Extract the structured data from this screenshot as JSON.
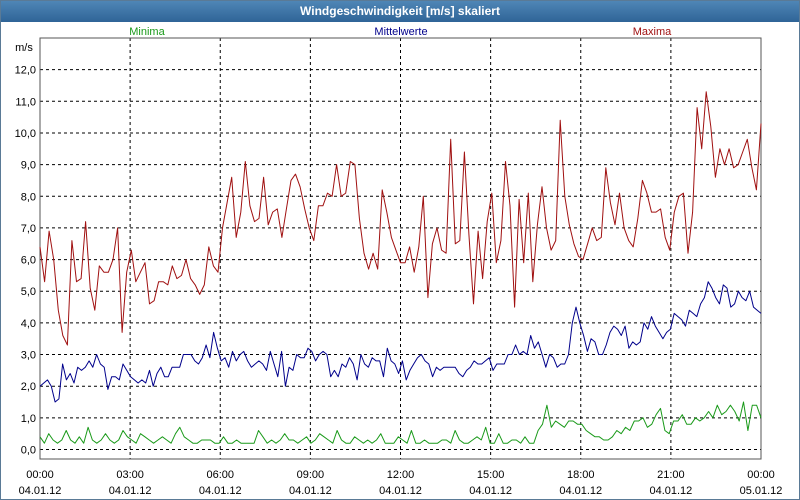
{
  "window": {
    "title": "Windgeschwindigkeit [m/s] skaliert"
  },
  "chart_data": {
    "type": "line",
    "title": "Windgeschwindigkeit [m/s] skaliert",
    "ylabel": "m/s",
    "ylim": [
      -0.3,
      13.0
    ],
    "xlim": [
      0,
      24
    ],
    "grid": true,
    "yticks": [
      "0,0",
      "1,0",
      "2,0",
      "3,0",
      "4,0",
      "5,0",
      "6,0",
      "7,0",
      "8,0",
      "9,0",
      "10,0",
      "11,0",
      "12,0"
    ],
    "xticks": [
      {
        "time": "00:00",
        "date": "04.01.12"
      },
      {
        "time": "03:00",
        "date": "04.01.12"
      },
      {
        "time": "06:00",
        "date": "04.01.12"
      },
      {
        "time": "09:00",
        "date": "04.01.12"
      },
      {
        "time": "12:00",
        "date": "04.01.12"
      },
      {
        "time": "15:00",
        "date": "04.01.12"
      },
      {
        "time": "18:00",
        "date": "04.01.12"
      },
      {
        "time": "21:00",
        "date": "04.01.12"
      },
      {
        "time": "00:00",
        "date": "05.01.12"
      }
    ],
    "series": [
      {
        "name": "Minima",
        "color": "#1a9a1a",
        "values": [
          0.4,
          0.2,
          0.5,
          0.3,
          0.2,
          0.3,
          0.6,
          0.3,
          0.2,
          0.4,
          0.2,
          0.7,
          0.3,
          0.2,
          0.3,
          0.5,
          0.3,
          0.2,
          0.3,
          0.6,
          0.4,
          0.3,
          0.2,
          0.5,
          0.4,
          0.3,
          0.2,
          0.3,
          0.4,
          0.3,
          0.2,
          0.5,
          0.7,
          0.4,
          0.3,
          0.2,
          0.2,
          0.3,
          0.3,
          0.3,
          0.2,
          0.2,
          0.4,
          0.2,
          0.2,
          0.3,
          0.2,
          0.2,
          0.2,
          0.2,
          0.6,
          0.4,
          0.2,
          0.3,
          0.2,
          0.3,
          0.5,
          0.3,
          0.3,
          0.2,
          0.3,
          0.4,
          0.2,
          0.3,
          0.5,
          0.4,
          0.3,
          0.2,
          0.6,
          0.3,
          0.2,
          0.2,
          0.4,
          0.3,
          0.2,
          0.3,
          0.2,
          0.3,
          0.5,
          0.2,
          0.2,
          0.2,
          0.4,
          0.3,
          0.2,
          0.6,
          0.2,
          0.2,
          0.3,
          0.2,
          0.2,
          0.2,
          0.3,
          0.3,
          0.2,
          0.6,
          0.3,
          0.2,
          0.2,
          0.3,
          0.4,
          0.3,
          0.7,
          0.2,
          0.2,
          0.5,
          0.2,
          0.2,
          0.3,
          0.3,
          0.2,
          0.4,
          0.2,
          0.2,
          0.6,
          0.8,
          1.4,
          0.7,
          0.9,
          0.8,
          0.7,
          0.9,
          0.9,
          0.8,
          0.8,
          0.6,
          0.5,
          0.4,
          0.4,
          0.3,
          0.3,
          0.4,
          0.6,
          0.5,
          0.7,
          0.6,
          0.9,
          0.9,
          1.0,
          0.7,
          0.8,
          1.1,
          1.3,
          0.6,
          0.5,
          0.9,
          0.9,
          1.1,
          0.8,
          0.8,
          1.0,
          0.9,
          1.0,
          1.2,
          1.0,
          1.4,
          1.1,
          1.2,
          1.4,
          1.2,
          0.9,
          1.5,
          0.6,
          1.4,
          1.4,
          1.0
        ]
      },
      {
        "name": "Mittelwerte",
        "color": "#00008b",
        "values": [
          2.0,
          2.1,
          2.2,
          2.0,
          1.5,
          1.6,
          2.7,
          2.2,
          2.4,
          2.1,
          2.6,
          2.5,
          2.6,
          2.8,
          2.6,
          3.0,
          2.7,
          2.6,
          1.9,
          2.3,
          2.3,
          2.2,
          2.7,
          2.5,
          2.3,
          2.2,
          2.1,
          2.2,
          2.1,
          2.5,
          2.0,
          2.4,
          2.6,
          2.3,
          2.3,
          2.6,
          2.6,
          2.6,
          3.0,
          3.0,
          3.0,
          2.8,
          2.7,
          2.9,
          3.3,
          2.9,
          3.7,
          3.2,
          2.8,
          2.9,
          2.6,
          3.1,
          2.8,
          3.0,
          3.1,
          2.8,
          2.6,
          2.7,
          2.8,
          2.7,
          2.5,
          3.1,
          2.7,
          2.3,
          3.1,
          2.0,
          2.6,
          2.5,
          3.0,
          2.9,
          2.9,
          3.2,
          3.1,
          2.8,
          3.0,
          3.1,
          3.0,
          2.3,
          2.5,
          2.3,
          2.7,
          2.6,
          2.9,
          2.7,
          2.2,
          3.0,
          2.7,
          2.6,
          2.9,
          2.8,
          2.8,
          2.3,
          3.2,
          2.8,
          2.7,
          2.4,
          2.8,
          2.2,
          2.5,
          2.7,
          2.9,
          3.0,
          2.8,
          2.7,
          2.3,
          2.6,
          2.5,
          2.6,
          2.6,
          2.6,
          2.6,
          2.4,
          2.3,
          2.5,
          2.6,
          2.8,
          2.7,
          2.7,
          2.8,
          2.9,
          2.5,
          2.7,
          2.7,
          2.7,
          3.0,
          3.0,
          3.3,
          3.0,
          3.1,
          3.0,
          3.6,
          3.2,
          3.4,
          3.0,
          2.6,
          3.0,
          2.9,
          2.6,
          2.7,
          2.7,
          3.0,
          4.0,
          4.5,
          4.0,
          3.6,
          3.1,
          3.5,
          3.4,
          3.0,
          3.0,
          3.3,
          3.7,
          3.9,
          3.8,
          3.6,
          3.9,
          3.2,
          3.4,
          3.3,
          3.4,
          4.0,
          3.8,
          4.2,
          3.9,
          3.7,
          3.5,
          3.7,
          3.8,
          4.3,
          4.2,
          4.1,
          3.9,
          4.4,
          4.3,
          4.2,
          4.6,
          4.8,
          5.3,
          5.1,
          4.8,
          4.6,
          5.2,
          5.1,
          4.5,
          4.6,
          5.0,
          4.8,
          4.7,
          5.0,
          4.5,
          4.4,
          4.3
        ]
      },
      {
        "name": "Maxima",
        "color": "#a01010",
        "values": [
          6.4,
          5.3,
          6.9,
          6.0,
          4.4,
          3.6,
          3.3,
          6.6,
          5.3,
          5.4,
          7.2,
          5.1,
          4.4,
          5.8,
          5.6,
          5.6,
          6.0,
          7.0,
          3.7,
          5.6,
          6.3,
          5.3,
          5.6,
          5.9,
          4.6,
          4.7,
          5.3,
          5.3,
          5.2,
          5.8,
          5.4,
          5.5,
          6.0,
          5.4,
          5.2,
          4.9,
          5.2,
          6.4,
          5.8,
          5.6,
          7.0,
          7.8,
          8.6,
          6.7,
          7.5,
          9.1,
          7.7,
          7.2,
          7.3,
          8.6,
          7.1,
          7.5,
          7.6,
          6.7,
          7.6,
          8.5,
          8.7,
          8.3,
          7.6,
          7.0,
          6.6,
          7.7,
          7.7,
          8.1,
          8.0,
          9.0,
          8.0,
          8.1,
          9.1,
          9.0,
          7.3,
          6.2,
          5.7,
          6.2,
          5.7,
          8.2,
          7.5,
          6.7,
          6.3,
          5.9,
          5.9,
          6.4,
          5.6,
          6.4,
          8.0,
          4.8,
          6.5,
          7.0,
          6.3,
          6.2,
          9.8,
          6.5,
          6.6,
          9.4,
          6.8,
          4.6,
          6.9,
          5.4,
          7.2,
          8.1,
          5.9,
          6.6,
          9.1,
          7.7,
          4.5,
          7.9,
          5.9,
          8.1,
          5.3,
          7.1,
          8.3,
          7.0,
          6.3,
          6.6,
          10.4,
          8.0,
          7.1,
          6.5,
          6.1,
          6.0,
          6.5,
          7.0,
          6.6,
          6.7,
          8.9,
          7.8,
          7.1,
          8.1,
          7.0,
          6.6,
          6.4,
          7.3,
          8.5,
          8.1,
          7.5,
          7.5,
          7.6,
          6.7,
          6.3,
          7.5,
          8.0,
          8.1,
          6.2,
          7.5,
          10.8,
          9.5,
          11.3,
          10.2,
          8.6,
          9.5,
          9.0,
          9.5,
          8.9,
          9.0,
          9.4,
          9.8,
          8.9,
          8.2,
          10.3
        ]
      }
    ]
  }
}
